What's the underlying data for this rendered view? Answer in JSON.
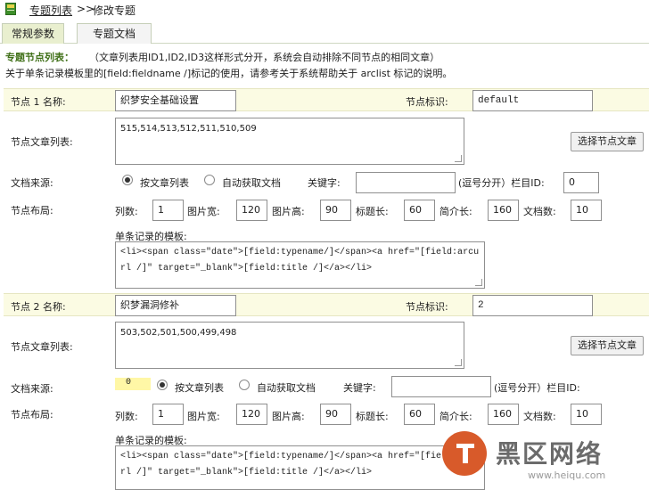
{
  "breadcrumb": {
    "link": "专题列表",
    "separator": ">>",
    "current": "修改专题"
  },
  "tabs": [
    {
      "label": "常规参数"
    },
    {
      "label": "专题文档"
    }
  ],
  "notes": {
    "title": "专题节点列表：",
    "line1": "（文章列表用ID1,ID2,ID3这样形式分开，系统会自动排除不同节点的相同文章）",
    "line2": "关于单条记录模板里的[field:fieldname /]标记的使用，请参考关于系统帮助关于 arclist 标记的说明。"
  },
  "nodes": [
    {
      "name_label": "节点 1 名称:",
      "name_value": "织梦安全基础设置",
      "flag_label": "节点标识:",
      "flag_value": "default",
      "list_label": "节点文章列表:",
      "list_value": "515,514,513,512,511,510,509",
      "select_btn": "选择节点文章",
      "source_label": "文档来源:",
      "radio_manual": "按文章列表",
      "radio_auto": "自动获取文档",
      "keyword_label": "关键字:",
      "keyword_value": "",
      "keyword_hint": "(逗号分开）栏目ID:",
      "typeid_value": "0",
      "layout_label": "节点布局:",
      "cols_label": "列数:",
      "cols_value": "1",
      "imgw_label": "图片宽:",
      "imgw_value": "120",
      "imgh_label": "图片高:",
      "imgh_value": "90",
      "titlelen_label": "标题长:",
      "titlelen_value": "60",
      "infolen_label": "简介长:",
      "infolen_value": "160",
      "rownum_label": "文档数:",
      "rownum_value": "10",
      "tpl_label": "单条记录的模板:",
      "tpl_line1": "<li><span class=\"date\">[field:typename/]</span><a href=\"[field:arcu",
      "tpl_line2": "rl /]\" target=\"_blank\">[field:title /]</a></li>"
    },
    {
      "name_label": "节点 2 名称:",
      "name_value": "织梦漏洞修补",
      "flag_label": "节点标识:",
      "flag_value": "2",
      "list_label": "节点文章列表:",
      "list_value": "503,502,501,500,499,498",
      "select_btn": "选择节点文章",
      "source_label": "文档来源:",
      "typeid_value": "0",
      "radio_manual": "按文章列表",
      "radio_auto": "自动获取文档",
      "keyword_label": "关键字:",
      "keyword_value": "",
      "keyword_hint": "(逗号分开）栏目ID:",
      "layout_label": "节点布局:",
      "cols_label": "列数:",
      "cols_value": "1",
      "imgw_label": "图片宽:",
      "imgw_value": "120",
      "imgh_label": "图片高:",
      "imgh_value": "90",
      "titlelen_label": "标题长:",
      "titlelen_value": "60",
      "infolen_label": "简介长:",
      "infolen_value": "160",
      "rownum_label": "文档数:",
      "rownum_value": "10",
      "tpl_label": "单条记录的模板:",
      "tpl_line1": "<li><span class=\"date\">[field:typename/]</span><a href=\"[field:arcu",
      "tpl_line2": "rl /]\" target=\"_blank\">[field:title /]</a></li>"
    }
  ],
  "watermark": {
    "title": "黑区网络",
    "url": "www.heiqu.com"
  },
  "colors": {
    "tab_active": "#e9efcf",
    "row_highlight": "#fbfbe3",
    "notes_title": "#3f6f17"
  }
}
